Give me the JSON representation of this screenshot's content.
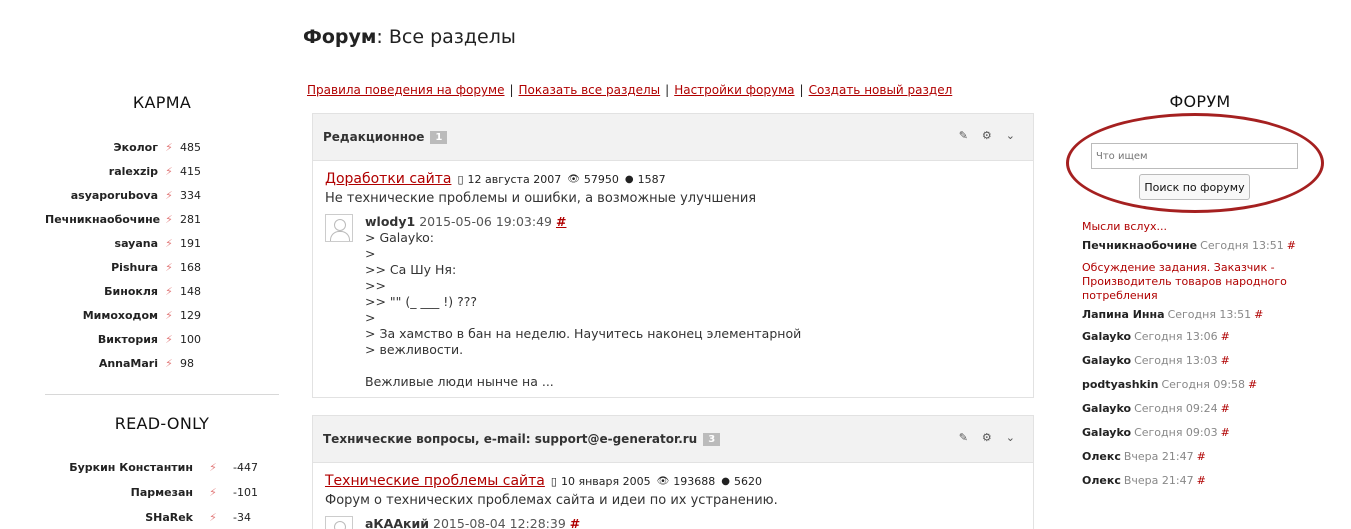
{
  "page": {
    "title_bold": "Форум",
    "title_rest": ": Все разделы"
  },
  "top_links": [
    "Правила поведения на форуме",
    "Показать все разделы",
    "Настройки форума",
    "Создать новый раздел"
  ],
  "karma": {
    "heading": "КАРМА",
    "items": [
      {
        "name": "Эколог",
        "value": "485"
      },
      {
        "name": "ralexzip",
        "value": "415"
      },
      {
        "name": "asyaporubova",
        "value": "334"
      },
      {
        "name": "Печникнаобочине",
        "value": "281"
      },
      {
        "name": "sayana",
        "value": "191"
      },
      {
        "name": "Pishura",
        "value": "168"
      },
      {
        "name": "Бинокля",
        "value": "148"
      },
      {
        "name": "Мимоходом",
        "value": "129"
      },
      {
        "name": "Виктория",
        "value": "100"
      },
      {
        "name": "AnnaMari",
        "value": "98"
      }
    ]
  },
  "readonly": {
    "heading": "READ-ONLY",
    "items": [
      {
        "name": "Буркин Константин",
        "value": "-447"
      },
      {
        "name": "Пармезан",
        "value": "-101"
      },
      {
        "name": "SHaRek",
        "value": "-34"
      }
    ]
  },
  "sections": [
    {
      "name": "Редакционное",
      "num": "1",
      "topic": {
        "title": "Доработки сайта",
        "date": "12 августа 2007",
        "views": "57950",
        "comments": "1587"
      },
      "desc": "Не технические проблемы и ошибки, а возможные улучшения",
      "post": {
        "author": "wlody1",
        "date": "2015-05-06 19:03:49",
        "anchor": "#",
        "lines": [
          "> Galayko:",
          ">",
          ">> Са Шу Ня:",
          ">>",
          ">> \"\" (_ ___ !) ???",
          ">",
          "> За хамство в бан на неделю. Научитесь наконец элементарной",
          "> вежливости.",
          "",
          "Вежливые люди нынче на ..."
        ]
      }
    },
    {
      "name": "Технические вопросы, e-mail: support@e-generator.ru",
      "num": "3",
      "topic": {
        "title": "Технические проблемы сайта",
        "date": "10 января 2005",
        "views": "193688",
        "comments": "5620"
      },
      "desc": "Форум о технических проблемах сайта и идеи по их устранению.",
      "post": {
        "author": "аКААкий",
        "date": "2015-08-04 12:28:39",
        "anchor": "#",
        "lines": []
      }
    }
  ],
  "right": {
    "heading": "ФОРУМ",
    "search_placeholder": "Что ищем",
    "search_button": "Поиск по форуму",
    "activity": [
      {
        "title": "Мысли вслух...",
        "user": "Печникнаобочине",
        "time": "Сегодня 13:51",
        "anchor": "#"
      },
      {
        "title": "Обсуждение задания. Заказчик - Производитель товаров народного потребления",
        "user": "Лапина Инна",
        "time": "Сегодня 13:51",
        "anchor": "#"
      },
      {
        "title": "",
        "user": "Galayko",
        "time": "Сегодня 13:06",
        "anchor": "#"
      },
      {
        "title": "",
        "user": "Galayko",
        "time": "Сегодня 13:03",
        "anchor": "#"
      },
      {
        "title": "",
        "user": "podtyashkin",
        "time": "Сегодня 09:58",
        "anchor": "#"
      },
      {
        "title": "",
        "user": "Galayko",
        "time": "Сегодня 09:24",
        "anchor": "#"
      },
      {
        "title": "",
        "user": "Galayko",
        "time": "Сегодня 09:03",
        "anchor": "#"
      },
      {
        "title": "",
        "user": "Олекс",
        "time": "Вчера 21:47",
        "anchor": "#"
      },
      {
        "title": "",
        "user": "Олекс",
        "time": "Вчера 21:47",
        "anchor": "#"
      }
    ]
  }
}
